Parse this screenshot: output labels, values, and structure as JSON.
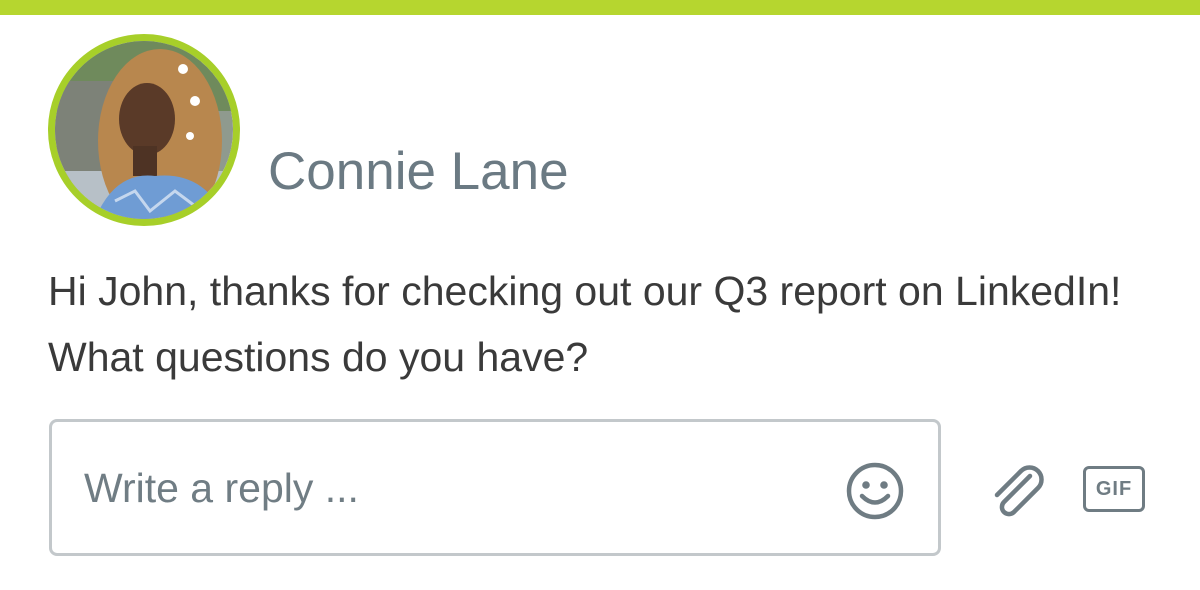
{
  "colors": {
    "accent_bar": "#b6d62f",
    "avatar_ring": "#a7cf29",
    "name_text": "#6b7a83",
    "message_text": "#3a3a3a",
    "icon_gray": "#6f7c83"
  },
  "sender": {
    "name": "Connie Lane",
    "avatar_icon": "profile-photo"
  },
  "message": {
    "text": "Hi John, thanks for checking out our Q3 report on LinkedIn! What questions do you have?"
  },
  "composer": {
    "placeholder": "Write a reply ...",
    "value": "",
    "emoji_icon": "smiley-face-icon",
    "attach_icon": "paperclip-icon",
    "gif_label": "GIF"
  }
}
